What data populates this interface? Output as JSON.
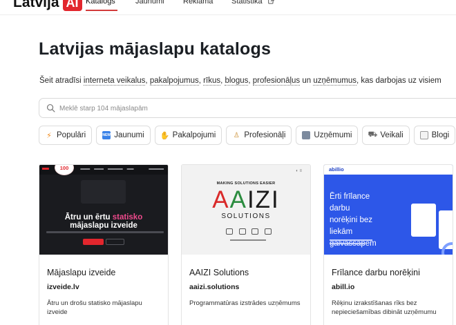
{
  "nav": {
    "logo_text": "Latvija",
    "logo_badge": "AI",
    "links": [
      "Katalogs",
      "Jaunumi",
      "Reklāma",
      "Statistika"
    ]
  },
  "header": {
    "title": "Latvijas mājaslapu katalogs",
    "intro_prefix": "Šeit atradīsi ",
    "intro_links": [
      "interneta veikalus",
      "pakalpojumus",
      "rīkus",
      "blogus",
      "profesionāļus",
      "uzņēmumus"
    ],
    "intro_suffix": ", kas darbojas uz visiem"
  },
  "search": {
    "placeholder": "Meklē starp 104 mājaslapām"
  },
  "categories": [
    {
      "label": "Populāri",
      "icon": "lightning-icon"
    },
    {
      "label": "Jaunumi",
      "icon": "new-icon"
    },
    {
      "label": "Pakalpojumi",
      "icon": "handshake-icon"
    },
    {
      "label": "Profesionāļi",
      "icon": "person-icon"
    },
    {
      "label": "Uzņēmumi",
      "icon": "building-icon"
    },
    {
      "label": "Veikali",
      "icon": "cart-icon"
    },
    {
      "label": "Blogi",
      "icon": "document-icon"
    }
  ],
  "cards": [
    {
      "title": "Mājaslapu izveide",
      "domain": "izveide.lv",
      "description": "Ātru un drošu statisko mājaslapu izveide",
      "thumb": {
        "headline_1": "Ātru un ērtu",
        "headline_accent": "statisko",
        "headline_2": "mājaslapu izveide",
        "badge": "100"
      }
    },
    {
      "title": "AAIZI Solutions",
      "domain": "aaizi.solutions",
      "description": "Programmatūras izstrādes uzņēmums",
      "thumb": {
        "tagline": "MAKING SOLUTIONS EASIER",
        "logo_a1": "A",
        "logo_a2": "A",
        "logo_rest": "IZI",
        "logo_sub": "SOLUTIONS"
      }
    },
    {
      "title": "Frīlance darbu norēķini",
      "domain": "abill.io",
      "description": "Rēķinu izrakstīšanas rīks bez nepieciešamības dibināt uzņēmumu",
      "thumb": {
        "brand": "abillio",
        "headline": "Ērti frīlance darbu norēķini bez liekām galvassāpēm"
      }
    }
  ],
  "colors": {
    "accent": "#e2262d",
    "link_underline": "#d23a3a"
  }
}
